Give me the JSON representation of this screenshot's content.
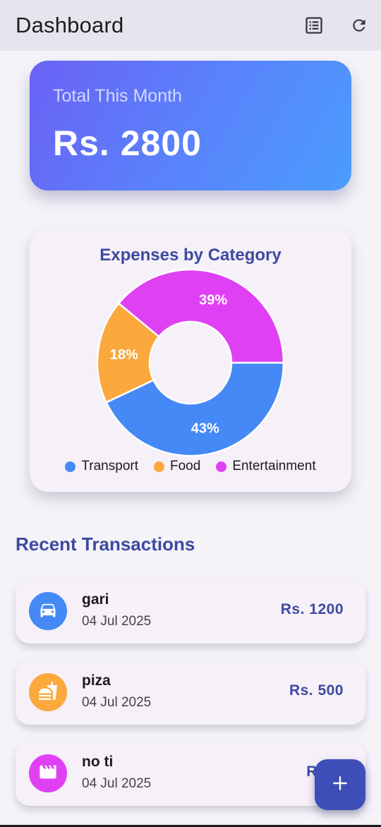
{
  "appbar": {
    "title": "Dashboard",
    "actions": [
      {
        "icon": "list-view-icon"
      },
      {
        "icon": "refresh-icon"
      }
    ]
  },
  "summary": {
    "label": "Total This Month",
    "value": "Rs. 2800"
  },
  "chart_data": {
    "type": "pie",
    "donut": true,
    "title": "Expenses by Category",
    "categories": [
      "Transport",
      "Food",
      "Entertainment"
    ],
    "values": [
      43,
      18,
      39
    ],
    "labels": [
      "43%",
      "18%",
      "39%"
    ],
    "colors": [
      "#4489f5",
      "#fba83c",
      "#e040f4"
    ],
    "legend_position": "bottom"
  },
  "transactions": {
    "title": "Recent Transactions",
    "items": [
      {
        "name": "gari",
        "date": "04 Jul 2025",
        "amount": "Rs. 1200",
        "icon": "car-icon",
        "color": "#4489f5"
      },
      {
        "name": "piza",
        "date": "04 Jul 2025",
        "amount": "Rs. 500",
        "icon": "fastfood-icon",
        "color": "#fba83c"
      },
      {
        "name": "no ti",
        "date": "04 Jul 2025",
        "amount": "Rs. 1",
        "icon": "movie-icon",
        "color": "#e040f4"
      }
    ]
  },
  "fab": {
    "icon": "plus-icon",
    "symbol": "+"
  }
}
